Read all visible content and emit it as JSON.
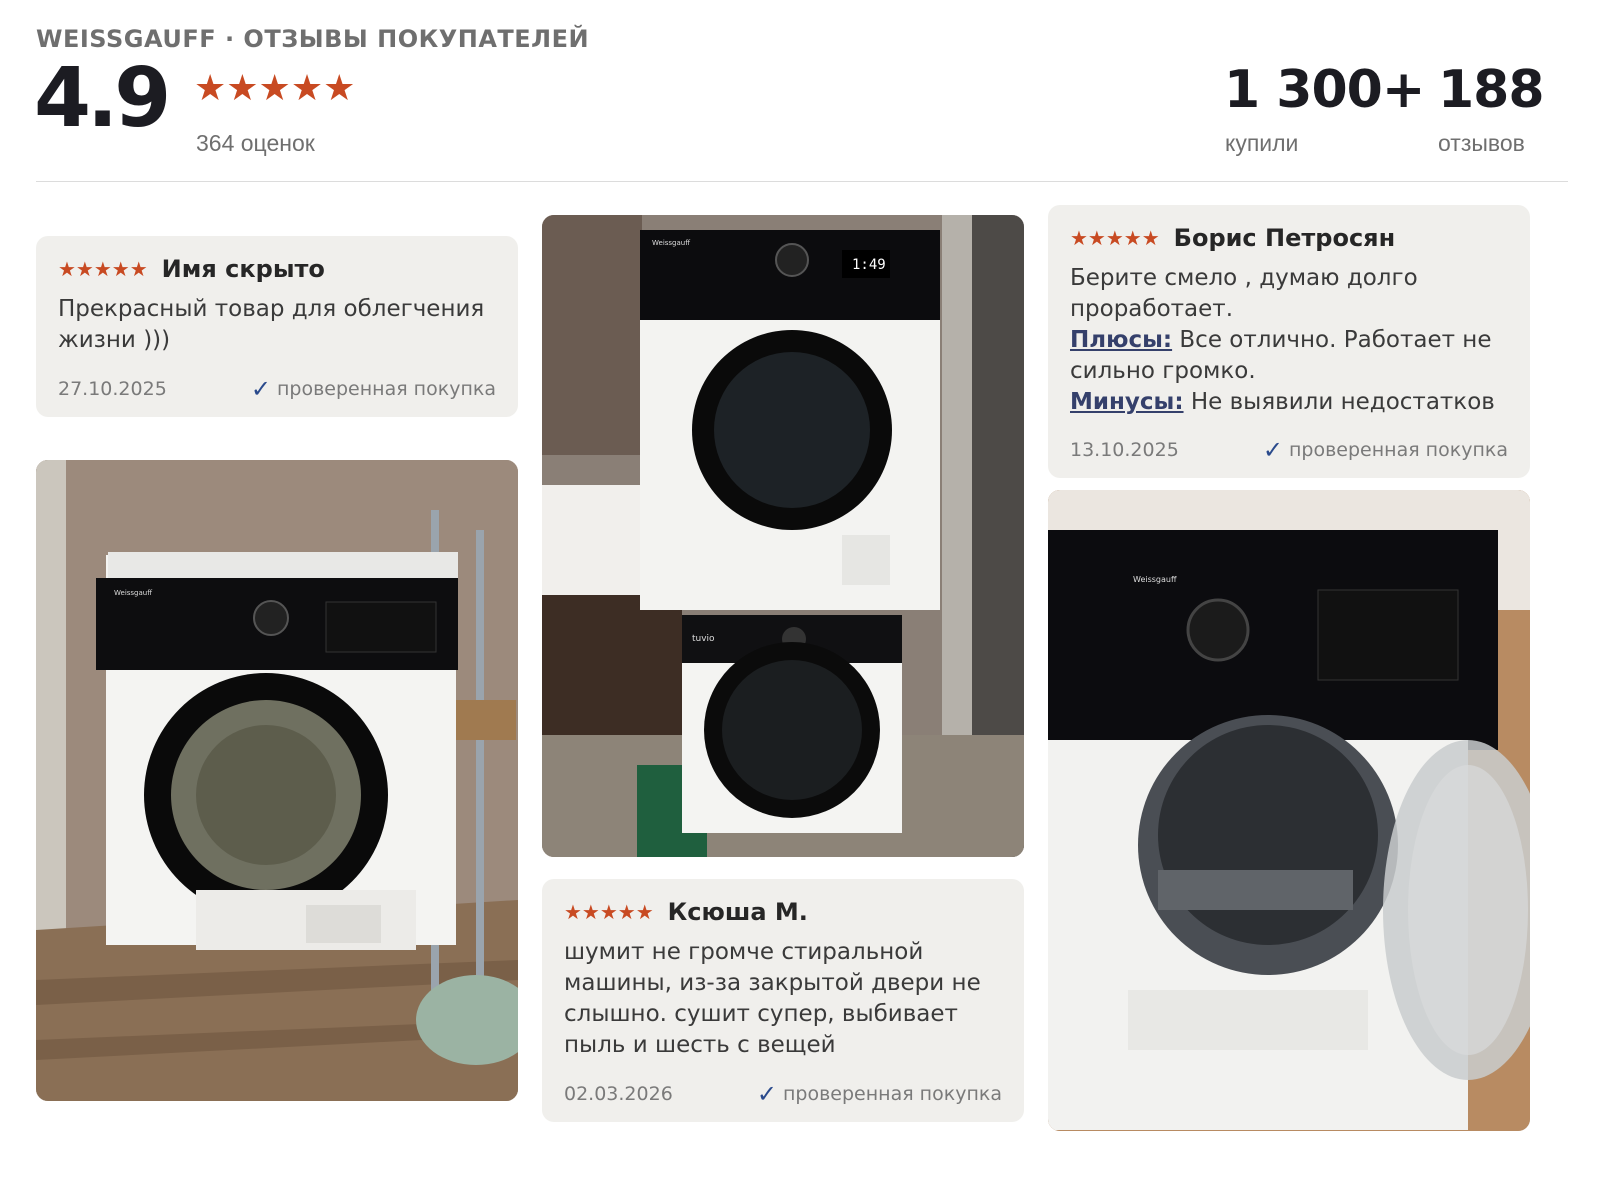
{
  "header": {
    "brand_title": "WEISSGAUFF · ОТЗЫВЫ ПОКУПАТЕЛЕЙ",
    "average_rating": "4.9",
    "stars": "★★★★★",
    "rating_count": "364 оценок",
    "bought_value": "1 300+",
    "bought_label": "купили",
    "reviews_value": "188",
    "reviews_label": "отзывов"
  },
  "reviews": [
    {
      "stars": "★★★★★",
      "author": "Имя скрыто",
      "text": "Прекрасный товар для облегчения жизни )))",
      "date": "27.10.2025",
      "verified": "проверенная покупка"
    },
    {
      "stars": "★★★★★",
      "author": "Борис Петросян",
      "text": "Берите смело , думаю долго проработает.",
      "pros_label": "Плюсы:",
      "pros": "Все отлично. Работает не сильно громко.",
      "cons_label": "Минусы:",
      "cons": "Не выявили недостатков",
      "date": "13.10.2025",
      "verified": "проверенная покупка"
    },
    {
      "stars": "★★★★★",
      "author": "Ксюша М.",
      "text": "шумит не громче стиральной машины, из-за закрытой двери не слышно. сушит супер, выбивает пыль и шесть с вещей",
      "date": "02.03.2026",
      "verified": "проверенная покупка"
    }
  ],
  "photos": {
    "brand_mark": "Weissgauff",
    "washer_mark": "tuvio",
    "display_value": "1:49"
  },
  "colors": {
    "star": "#c84a22",
    "check": "#2a4a8c",
    "card_bg": "#f0efec"
  }
}
